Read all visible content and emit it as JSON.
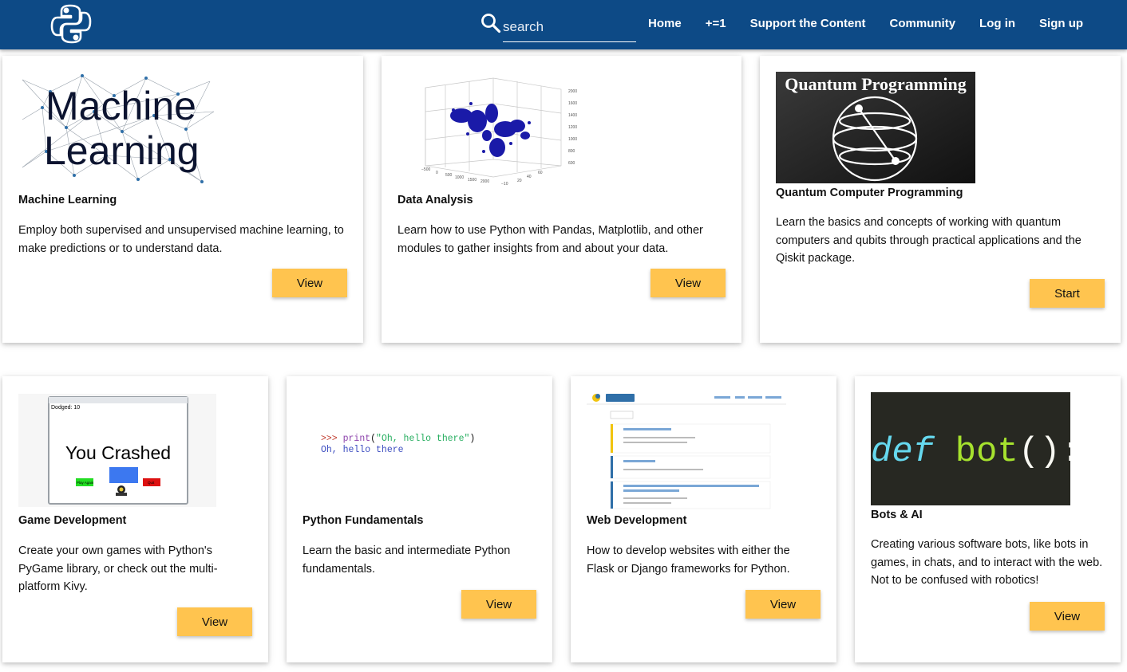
{
  "nav": {
    "search_placeholder": "search",
    "links": [
      "Home",
      "+=1",
      "Support the Content",
      "Community",
      "Log in",
      "Sign up"
    ]
  },
  "cards": [
    {
      "title": "Machine Learning",
      "description": "Employ both supervised and unsupervised machine learning, to make predictions or to understand data.",
      "button": "View",
      "image_text": [
        "Machine",
        "Learning"
      ]
    },
    {
      "title": "Data Analysis",
      "description": "Learn how to use Python with Pandas, Matplotlib, and other modules to gather insights from and about your data.",
      "button": "View"
    },
    {
      "title": "Quantum Computer Programming",
      "description": "Learn the basics and concepts of working with quantum computers and qubits through practical applications and the Qiskit package.",
      "button": "Start",
      "image_text": "Quantum Programming"
    },
    {
      "title": "Game Development",
      "description": "Create your own games with Python's PyGame library, or check out the multi-platform Kivy.",
      "button": "View",
      "image_text": {
        "score": "Dodged: 10",
        "crashed": "You Crashed",
        "play_again": "Play Again",
        "quit": "Quit"
      }
    },
    {
      "title": "Python Fundamentals",
      "description": "Learn the basic and intermediate Python fundamentals.",
      "button": "View",
      "code": {
        "prompt": ">>>",
        "func": "print",
        "string": "\"Oh, hello there\"",
        "output": "Oh, hello there"
      }
    },
    {
      "title": "Web Development",
      "description": "How to develop websites with either the Flask or Django frameworks for Python.",
      "button": "View"
    },
    {
      "title": "Bots & AI",
      "description": "Creating various software bots, like bots in games, in chats, and to interact with the web. Not to be confused with robotics!",
      "button": "View",
      "image_text": {
        "keyword": "def",
        "name": "bot",
        "punct": "():"
      }
    }
  ],
  "colors": {
    "navbar": "#0d4a86",
    "button": "#ffc44f",
    "bot_bg": "#272822",
    "bot_keyword": "#66d9ef",
    "bot_name": "#a6e22e"
  }
}
